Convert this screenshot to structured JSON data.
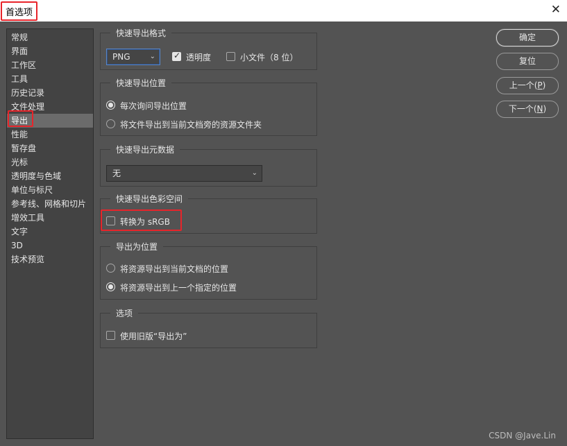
{
  "window": {
    "title": "首选项"
  },
  "sidebar": {
    "items": [
      {
        "label": "常规"
      },
      {
        "label": "界面"
      },
      {
        "label": "工作区"
      },
      {
        "label": "工具"
      },
      {
        "label": "历史记录"
      },
      {
        "label": "文件处理"
      },
      {
        "label": "导出",
        "active": true
      },
      {
        "label": "性能"
      },
      {
        "label": "暂存盘"
      },
      {
        "label": "光标"
      },
      {
        "label": "透明度与色域"
      },
      {
        "label": "单位与标尺"
      },
      {
        "label": "参考线、网格和切片"
      },
      {
        "label": "增效工具"
      },
      {
        "label": "文字"
      },
      {
        "label": "3D"
      },
      {
        "label": "技术预览"
      }
    ]
  },
  "quick_export_format": {
    "title": "快速导出格式",
    "format_value": "PNG",
    "transparency_label": "透明度",
    "transparency_checked": true,
    "small_file_label": "小文件（8 位）",
    "small_file_checked": false
  },
  "quick_export_location": {
    "title": "快速导出位置",
    "options": [
      {
        "label": "每次询问导出位置",
        "selected": true
      },
      {
        "label": "将文件导出到当前文档旁的资源文件夹",
        "selected": false
      }
    ]
  },
  "quick_export_metadata": {
    "title": "快速导出元数据",
    "value": "无"
  },
  "quick_export_colorspace": {
    "title": "快速导出色彩空间",
    "convert_label": "转换为 sRGB",
    "convert_checked": false
  },
  "export_as_location": {
    "title": "导出为位置",
    "options": [
      {
        "label": "将资源导出到当前文档的位置",
        "selected": false
      },
      {
        "label": "将资源导出到上一个指定的位置",
        "selected": true
      }
    ]
  },
  "options": {
    "title": "选项",
    "legacy_label": "使用旧版“导出为”",
    "legacy_checked": false
  },
  "buttons": {
    "ok": "确定",
    "reset": "复位",
    "prev": "上一个(",
    "prev_key": "P",
    "prev_end": ")",
    "next": "下一个(",
    "next_key": "N",
    "next_end": ")"
  },
  "watermark": "CSDN @Jave.Lin",
  "colors": {
    "highlight": "#e8242a",
    "background": "#535353",
    "sidebar": "#434343"
  },
  "icons": {
    "close": "close-icon",
    "dropdown": "chevron-down-icon",
    "check": "checkmark-icon"
  }
}
